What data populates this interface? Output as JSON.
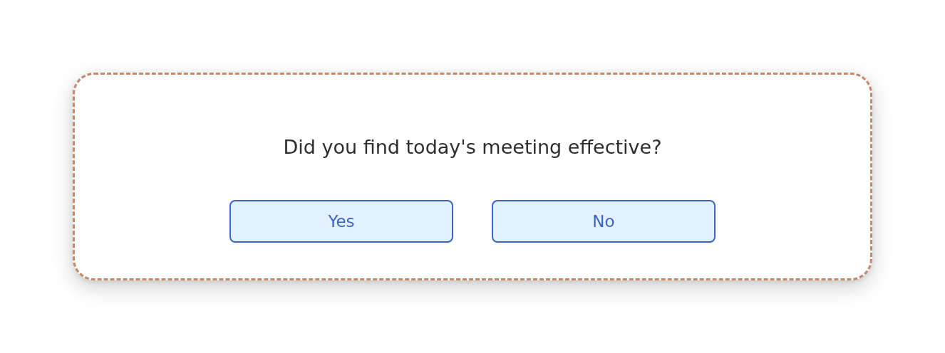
{
  "prompt": {
    "question": "Did you find today's meeting effective?",
    "buttons": [
      {
        "label": "Yes"
      },
      {
        "label": "No"
      }
    ]
  }
}
